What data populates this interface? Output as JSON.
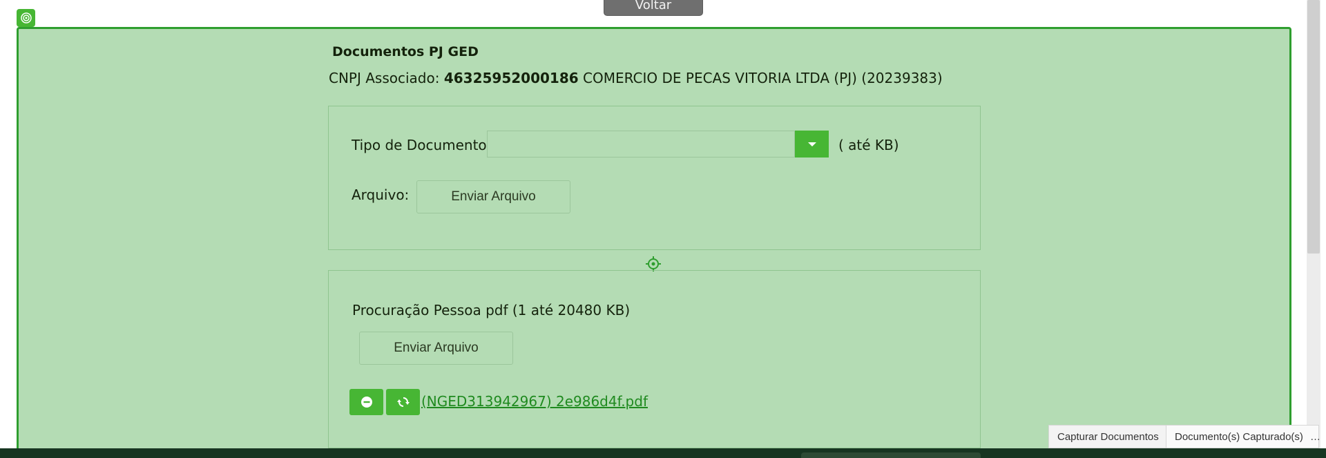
{
  "header": {
    "back_label": "Voltar"
  },
  "page": {
    "title": "Documentos PJ GED",
    "cnpj_label": "CNPJ Associado:",
    "cnpj_number": "46325952000186",
    "company": "COMERCIO DE PECAS VITORIA LTDA (PJ) (20239383)"
  },
  "upload_form": {
    "doc_type_label": "Tipo de Documento:",
    "doc_type_value": "",
    "size_hint": "( até KB)",
    "file_label": "Arquivo:",
    "send_label": "Enviar Arquivo"
  },
  "document_section": {
    "title": "Procuração Pessoa pdf (1 até 20480 KB)",
    "send_label": "Enviar Arquivo",
    "file_link": "(NGED313942967) 2e986d4f.pdf"
  },
  "tabs": [
    {
      "label": "Capturar Documentos"
    },
    {
      "label": "Documento(s) Capturado(s)"
    }
  ],
  "tabs_more": "…",
  "colors": {
    "overlay_bg": "#b4dcb4",
    "overlay_border": "#2e9e2e",
    "accent_green": "#47b634",
    "link_green": "#1f8a1f"
  },
  "icons": {
    "corner": "target-icon",
    "section_marker": "crosshair-icon",
    "remove": "minus-circle-icon",
    "replace": "refresh-icon",
    "dropdown": "caret-down-icon"
  }
}
